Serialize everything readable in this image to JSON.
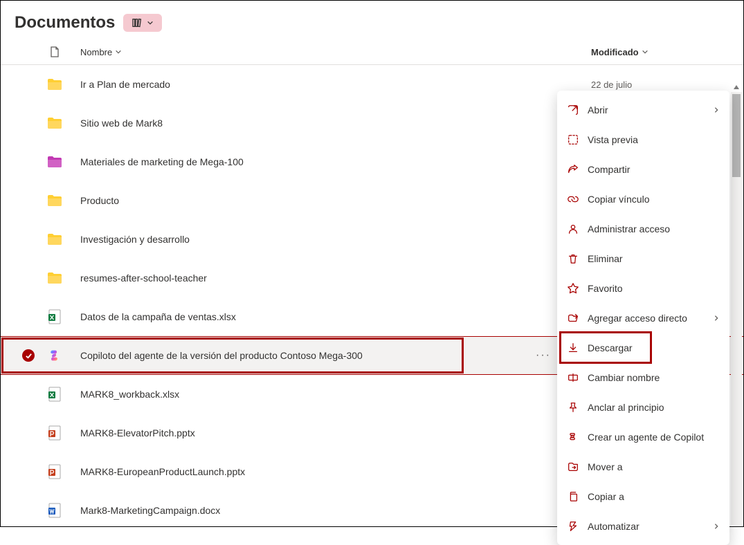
{
  "header": {
    "title": "Documentos"
  },
  "columns": {
    "name": "Nombre",
    "modified": "Modificado"
  },
  "files": [
    {
      "type": "folder",
      "color": "yellow",
      "name": "Ir a Plan de mercado",
      "modified": "22 de julio"
    },
    {
      "type": "folder",
      "color": "yellow",
      "name": "Sitio web de Mark8",
      "modified": ""
    },
    {
      "type": "folder",
      "color": "magenta",
      "name": "Materiales de marketing de Mega-100",
      "modified": ""
    },
    {
      "type": "folder",
      "color": "yellow",
      "name": "Producto",
      "modified": ""
    },
    {
      "type": "folder",
      "color": "yellow",
      "name": "Investigación y desarrollo",
      "modified": ""
    },
    {
      "type": "folder",
      "color": "yellow",
      "name": "resumes-after-school-teacher",
      "modified": ""
    },
    {
      "type": "xlsx",
      "name": "Datos de la campaña de ventas.xlsx",
      "modified": ""
    },
    {
      "type": "copilot",
      "name": "Copiloto del agente de la versión del producto Contoso Mega-300",
      "modified": "",
      "selected": true
    },
    {
      "type": "xlsx",
      "name": "MARK8_workback.xlsx",
      "modified": ""
    },
    {
      "type": "pptx",
      "name": "MARK8-ElevatorPitch.pptx",
      "modified": ""
    },
    {
      "type": "pptx",
      "name": "MARK8-EuropeanProductLaunch.pptx",
      "modified": ""
    },
    {
      "type": "docx",
      "name": "Mark8-MarketingCampaign.docx",
      "modified": ""
    }
  ],
  "menu": {
    "items": [
      {
        "icon": "open",
        "label": "Abrir",
        "submenu": true
      },
      {
        "icon": "preview",
        "label": "Vista previa"
      },
      {
        "icon": "share",
        "label": "Compartir"
      },
      {
        "icon": "link",
        "label": "Copiar vínculo"
      },
      {
        "icon": "access",
        "label": "Administrar acceso"
      },
      {
        "icon": "delete",
        "label": "Eliminar"
      },
      {
        "icon": "favorite",
        "label": "Favorito"
      },
      {
        "icon": "shortcut",
        "label": "Agregar acceso directo",
        "submenu": true
      },
      {
        "icon": "download",
        "label": "Descargar",
        "highlighted": true
      },
      {
        "icon": "rename",
        "label": "Cambiar nombre"
      },
      {
        "icon": "pin",
        "label": "Anclar al principio"
      },
      {
        "icon": "copilot",
        "label": "Crear un agente de Copilot"
      },
      {
        "icon": "move",
        "label": "Mover a"
      },
      {
        "icon": "copy",
        "label": "Copiar a"
      },
      {
        "icon": "automate",
        "label": "Automatizar",
        "submenu": true
      }
    ]
  },
  "colors": {
    "accent": "#a80000",
    "badge_bg": "#f5c9d0"
  }
}
